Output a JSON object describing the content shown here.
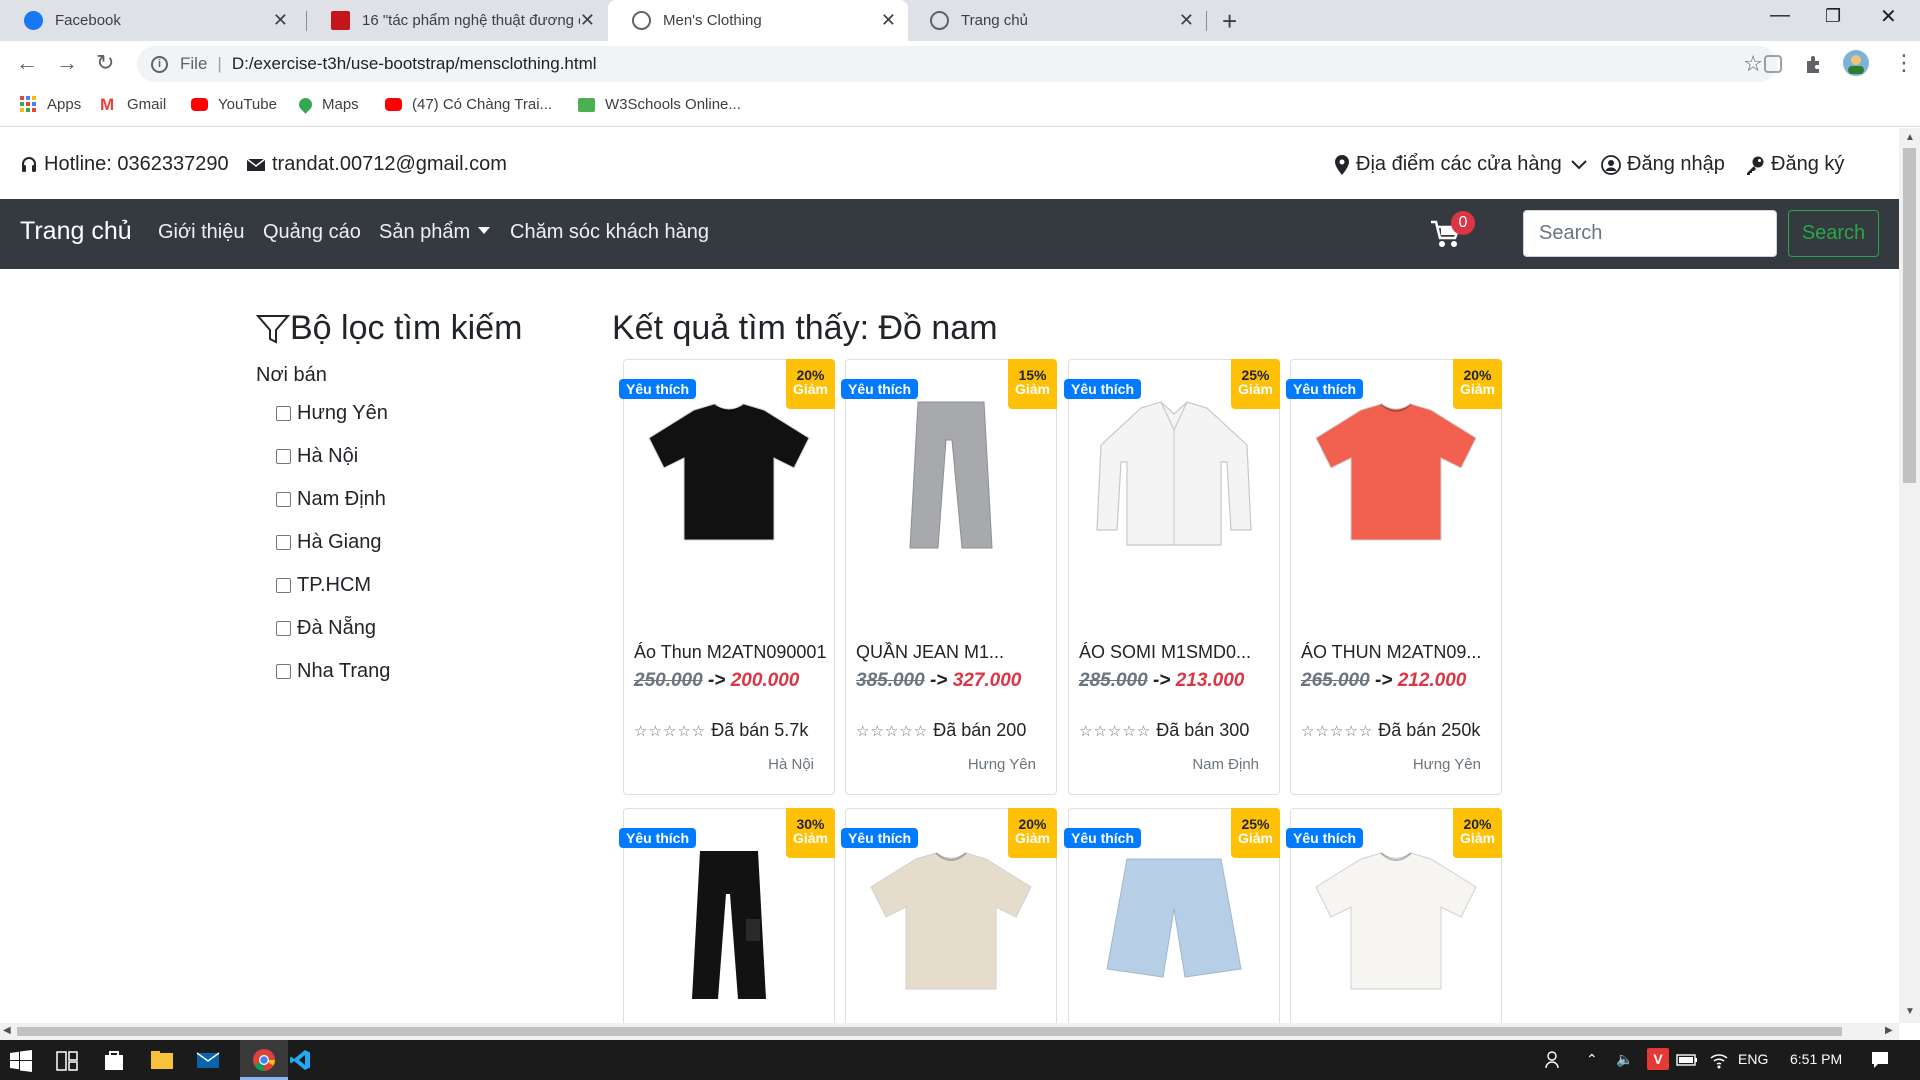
{
  "browser": {
    "tabs": [
      {
        "title": "Facebook",
        "active": false
      },
      {
        "title": "16 \"tác phẩm nghệ thuật đương đ",
        "active": false
      },
      {
        "title": "Men's Clothing",
        "active": true
      },
      {
        "title": "Trang chủ",
        "active": false
      }
    ],
    "url_scheme": "File",
    "url": "D:/exercise-t3h/use-bootstrap/mensclothing.html",
    "bookmarks": [
      "Apps",
      "Gmail",
      "YouTube",
      "Maps",
      "(47) Có Chàng Trai...",
      "W3Schools Online..."
    ]
  },
  "top_info": {
    "hotline": "Hotline: 0362337290",
    "email": "trandat.00712@gmail.com",
    "stores": "Địa điểm các cửa hàng",
    "login": "Đăng nhập",
    "register": "Đăng ký"
  },
  "navbar": {
    "brand": "Trang chủ",
    "links": [
      "Giới thiệu",
      "Quảng cáo",
      "Sản phẩm",
      "Chăm sóc khách hàng"
    ],
    "cart_count": "0",
    "search_placeholder": "Search",
    "search_button": "Search"
  },
  "filter": {
    "title": "Bộ lọc tìm kiếm",
    "section": "Nơi bán",
    "locations": [
      "Hưng Yên",
      "Hà Nội",
      "Nam Định",
      "Hà Giang",
      "TP.HCM",
      "Đà Nẵng",
      "Nha Trang"
    ]
  },
  "results_title": "Kết quả tìm thấy: Đồ nam",
  "badge_fav": "Yêu thích",
  "badge_off": "Giảm",
  "products": [
    {
      "name": "Áo Thun M2ATN090001",
      "old_price": "250.000",
      "arrow": "->",
      "new_price": "200.000",
      "discount": "20%",
      "sold": "Đã bán 5.7k",
      "location": "Hà Nội",
      "kind": "tee",
      "color": "#111111"
    },
    {
      "name": "QUẦN JEAN M1...",
      "old_price": "385.000",
      "arrow": "->",
      "new_price": "327.000",
      "discount": "15%",
      "sold": "Đã bán 200",
      "location": "Hưng Yên",
      "kind": "jeans",
      "color": "#a7a9ad"
    },
    {
      "name": "ÁO SOMI M1SMD0...",
      "old_price": "285.000",
      "arrow": "->",
      "new_price": "213.000",
      "discount": "25%",
      "sold": "Đã bán 300",
      "location": "Nam Định",
      "kind": "shirt",
      "color": "#f4f4f4"
    },
    {
      "name": "ÁO THUN M2ATN09...",
      "old_price": "265.000",
      "arrow": "->",
      "new_price": "212.000",
      "discount": "20%",
      "sold": "Đã bán 250k",
      "location": "Hưng Yên",
      "kind": "tee",
      "color": "#f2604f"
    },
    {
      "discount": "30%",
      "kind": "jogger",
      "color": "#121212"
    },
    {
      "discount": "20%",
      "kind": "tee",
      "color": "#e6dccb"
    },
    {
      "discount": "25%",
      "kind": "shorts",
      "color": "#b7cfe6"
    },
    {
      "discount": "20%",
      "kind": "tee",
      "color": "#f7f5f2"
    }
  ],
  "taskbar": {
    "lang": "ENG",
    "time": "6:51 PM"
  }
}
